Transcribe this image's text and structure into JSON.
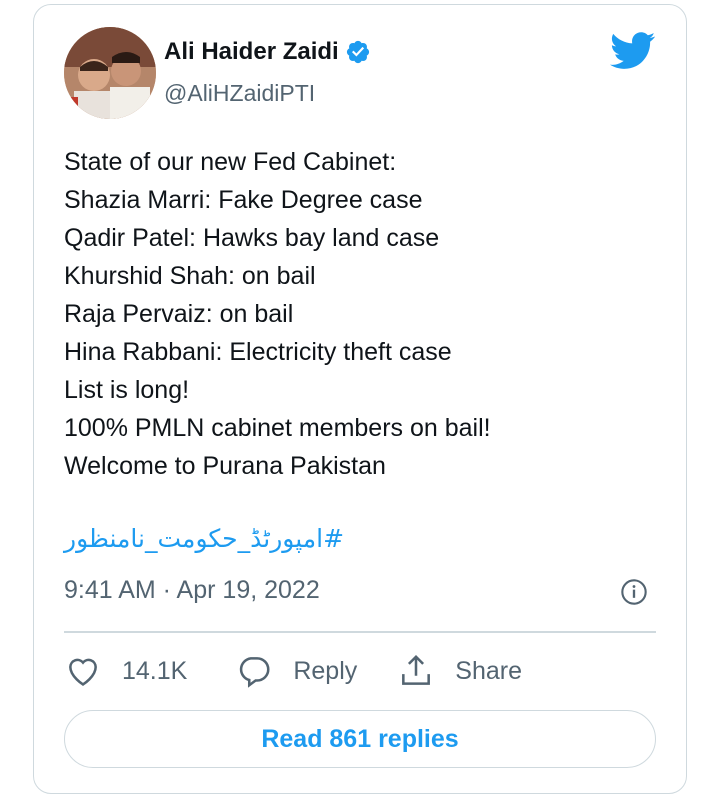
{
  "author": {
    "name": "Ali Haider Zaidi",
    "handle": "@AliHZaidiPTI",
    "verified_icon": "verified-badge-icon",
    "avatar_icon": "avatar-photo"
  },
  "brand": {
    "icon": "twitter-bird-icon",
    "color": "#1d9bf0"
  },
  "tweet": {
    "lines": [
      "State of our new Fed Cabinet:",
      "Shazia Marri: Fake Degree case",
      "Qadir Patel: Hawks bay land case",
      "Khurshid Shah: on bail",
      "Raja Pervaiz: on bail",
      "Hina Rabbani: Electricity theft case",
      "List is long!",
      "100% PMLN cabinet members on bail!",
      "Welcome to Purana Pakistan"
    ],
    "hashtag": "#امپورٹڈ_حکومت_نامنظور"
  },
  "meta": {
    "timestamp": "9:41 AM · Apr 19, 2022",
    "info_icon": "info-icon"
  },
  "actions": {
    "like_count": "14.1K",
    "reply_label": "Reply",
    "share_label": "Share"
  },
  "read_replies_label": "Read 861 replies",
  "colors": {
    "text": "#0f1419",
    "secondary": "#536471",
    "border": "#cfd9de",
    "accent": "#1d9bf0"
  }
}
